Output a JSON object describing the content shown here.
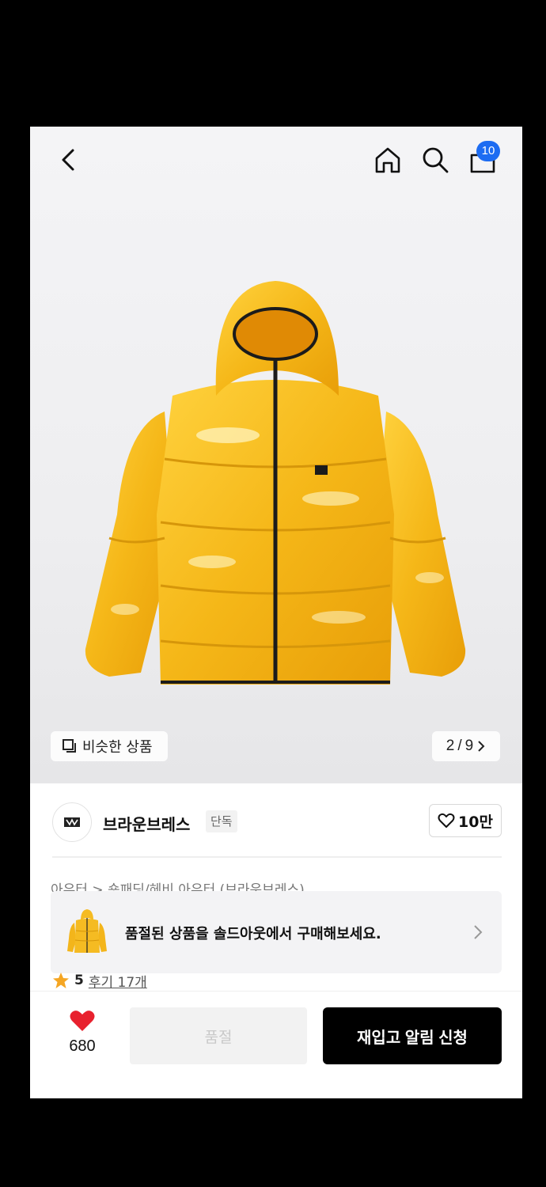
{
  "header": {
    "cart_badge": "10",
    "icons": [
      "back-icon",
      "home-icon",
      "search-icon",
      "cart-icon"
    ]
  },
  "gallery": {
    "similar_label": "비슷한 상품",
    "page_current": "2",
    "page_total": "9",
    "page_separator": "/"
  },
  "brand": {
    "name": "브라운브레스",
    "tag": "단독",
    "likes": "10만"
  },
  "category": "아우터 > 숏패딩/헤비 아우터 (브라운브레스)",
  "soldout_banner": {
    "text": "품절된 상품을 솔드아웃에서 구매해보세요."
  },
  "rating": {
    "score": "5",
    "reviews": "후기 17개"
  },
  "bottom": {
    "wish_count": "680",
    "soldout_label": "품절",
    "restock_label": "재입고 알림 신청"
  },
  "colors": {
    "accent_blue": "#1d6cf2",
    "heart_red": "#e8212e",
    "jacket_yellow": "#f3b51b",
    "star_orange": "#f5a623"
  }
}
